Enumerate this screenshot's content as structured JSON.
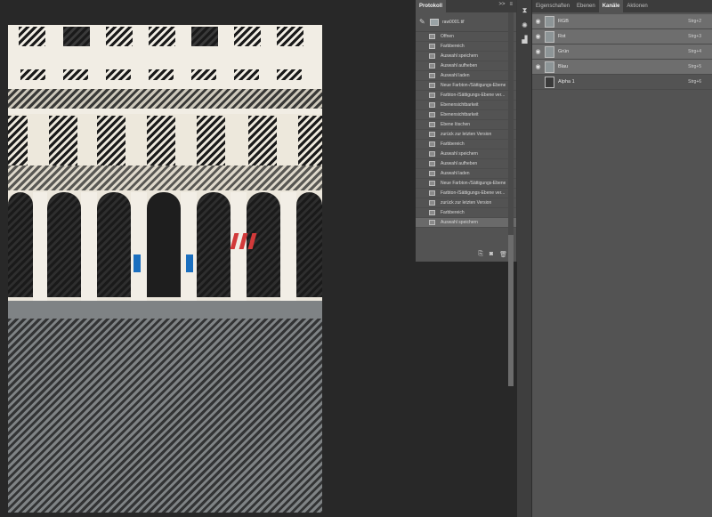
{
  "history_panel": {
    "tab": "Protokoll",
    "tab_icons": [
      ">>",
      "≡"
    ],
    "snapshot_label": "raw0001.tif",
    "steps": [
      "Öffnen",
      "Farbbereich",
      "Auswahl speichern",
      "Auswahl aufheben",
      "Auswahl laden",
      "Neue Farbton-/Sättigungs-Ebene",
      "Farbton-/Sättigungs-Ebene ver...",
      "Ebenensichtbarkeit",
      "Ebenensichtbarkeit",
      "Ebene löschen",
      "zurück zur letzten Version",
      "Farbbereich",
      "Auswahl speichern",
      "Auswahl aufheben",
      "Auswahl laden",
      "Neue Farbton-/Sättigungs-Ebene",
      "Farbton-/Sättigungs-Ebene ver...",
      "zurück zur letzten Version",
      "Farbbereich",
      "Auswahl speichern"
    ],
    "selected_step": "Auswahl speichern",
    "footer_icons": [
      "new-document-from-state-icon",
      "camera-icon",
      "trash-icon"
    ]
  },
  "channels_panel": {
    "tabs": [
      "Eigenschaften",
      "Ebenen",
      "Kanäle",
      "Aktionen"
    ],
    "active_tab": "Kanäle",
    "channels": [
      {
        "name": "RGB",
        "shortcut": "Strg+2"
      },
      {
        "name": "Rot",
        "shortcut": "Strg+3"
      },
      {
        "name": "Grün",
        "shortcut": "Strg+4"
      },
      {
        "name": "Blau",
        "shortcut": "Strg+5"
      },
      {
        "name": "Alpha 1",
        "shortcut": "Strg+6"
      }
    ]
  },
  "icons": {
    "eye": "eye-icon",
    "brush": "history-brush-icon"
  },
  "colors": {
    "workspace": "#282828",
    "panel": "#535353",
    "selected_row": "#6e6e6e",
    "tab_bar": "#3c3c3c"
  }
}
